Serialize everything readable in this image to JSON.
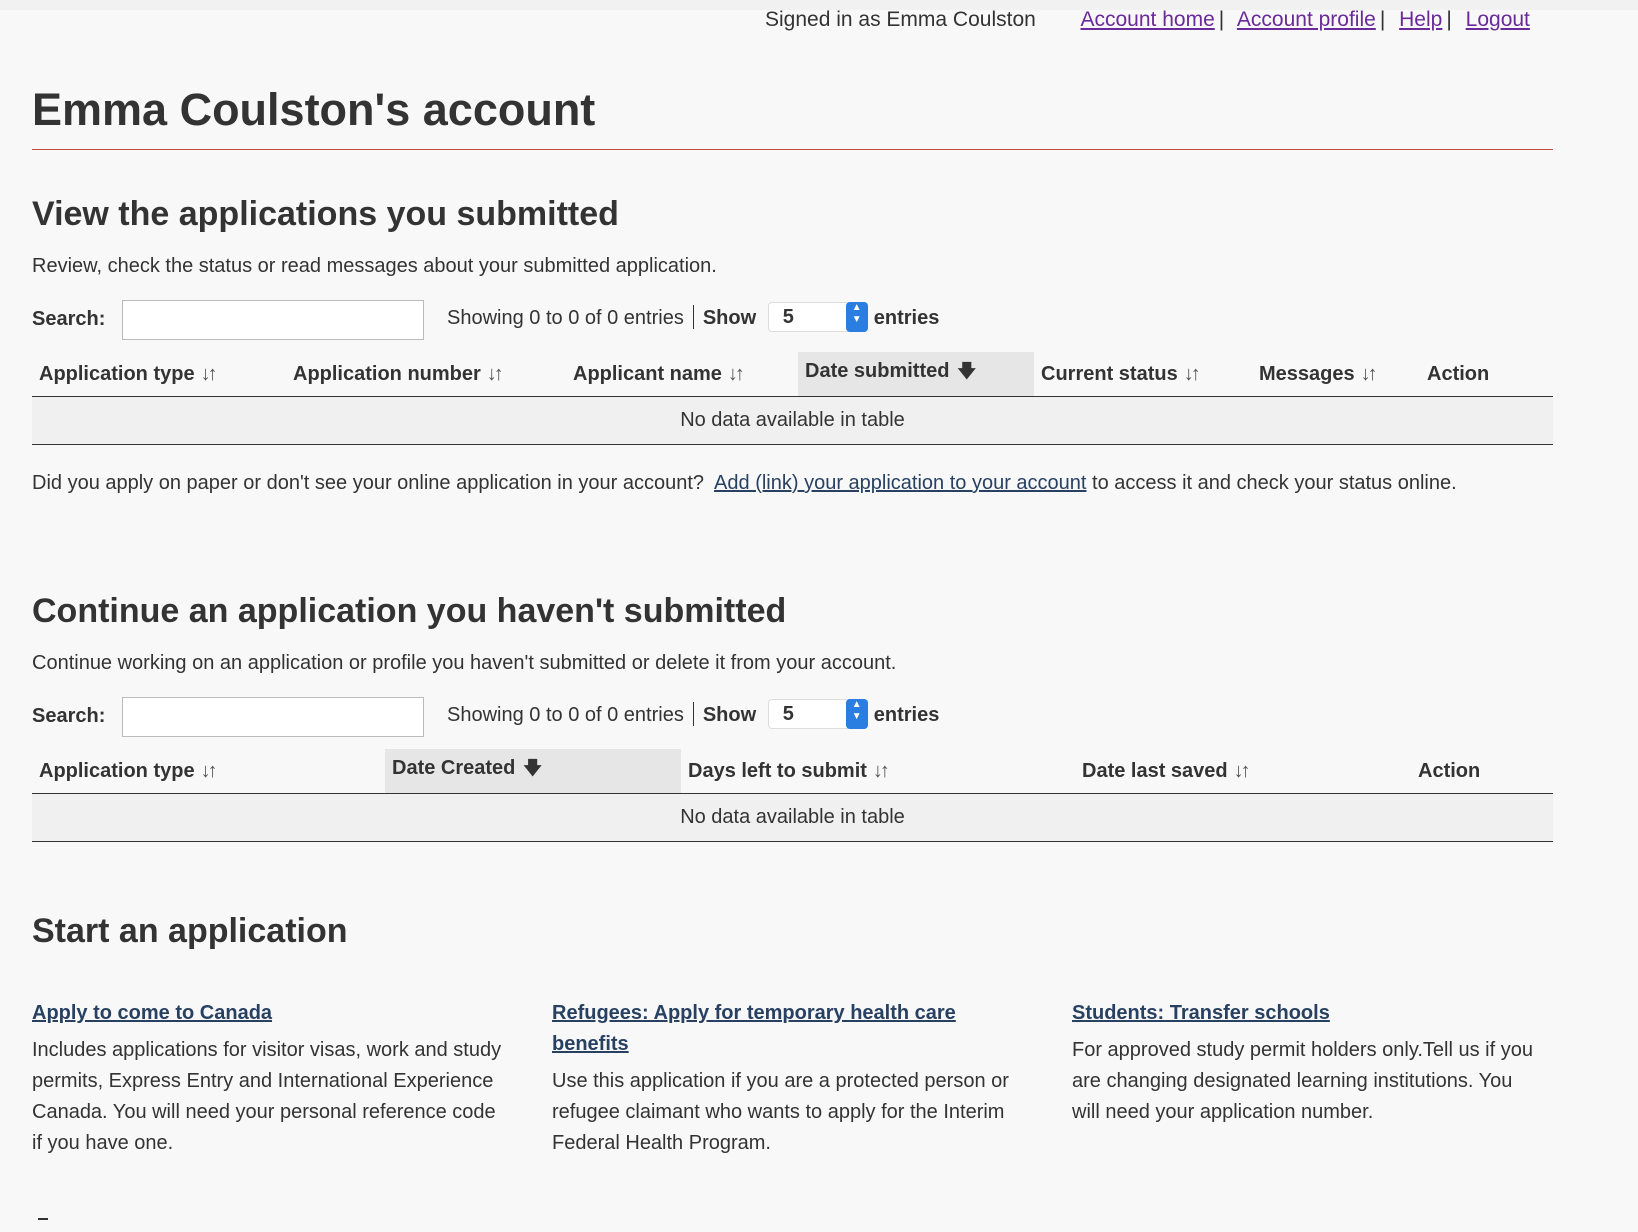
{
  "header": {
    "signed_in_text": "Signed in as Emma Coulston",
    "links": [
      "Account home",
      "Account profile",
      "Help",
      "Logout"
    ],
    "separator": "|"
  },
  "page_title": "Emma Coulston's account",
  "submitted": {
    "heading": "View the applications you submitted",
    "description": "Review, check the status or read messages about your submitted application.",
    "search_label": "Search:",
    "search_value": "",
    "showing_text": "Showing 0 to 0 of 0 entries",
    "show_label": "Show",
    "show_value": "5",
    "entries_label": "entries",
    "columns": [
      "Application type",
      "Application number",
      "Applicant name",
      "Date submitted",
      "Current status",
      "Messages",
      "Action"
    ],
    "sorted_column": "Date submitted",
    "empty_text": "No data available in table"
  },
  "paper_note": {
    "before": "Did you apply on paper or don't see your online application in your account?",
    "link": "Add (link) your application to your account",
    "after": "to access it and check your status online."
  },
  "unsubmitted": {
    "heading": "Continue an application you haven't submitted",
    "description": "Continue working on an application or profile you haven't submitted or delete it from your account.",
    "search_label": "Search:",
    "search_value": "",
    "showing_text": "Showing 0 to 0 of 0 entries",
    "show_label": "Show",
    "show_value": "5",
    "entries_label": "entries",
    "columns": [
      "Application type",
      "Date Created",
      "Days left to submit",
      "Date last saved",
      "Action"
    ],
    "sorted_column": "Date Created",
    "empty_text": "No data available in table"
  },
  "start": {
    "heading": "Start an application",
    "items": [
      {
        "title": "Apply to come to Canada",
        "description": "Includes applications for visitor visas, work and study permits, Express Entry and International Experience Canada. You will need your personal reference code if you have one."
      },
      {
        "title": "Refugees: Apply for temporary health care benefits",
        "description": "Use this application if you are a protected person or refugee claimant who wants to apply for the Interim Federal Health Program."
      },
      {
        "title": "Students: Transfer schools",
        "description": "For approved study permit holders only.Tell us if you are changing designated learning institutions. You will need your application number."
      }
    ]
  },
  "colors": {
    "link_purple": "#6a2a9a",
    "link_blue": "#284162",
    "title_rule": "#c84b4b",
    "select_accent": "#2a7de1"
  }
}
